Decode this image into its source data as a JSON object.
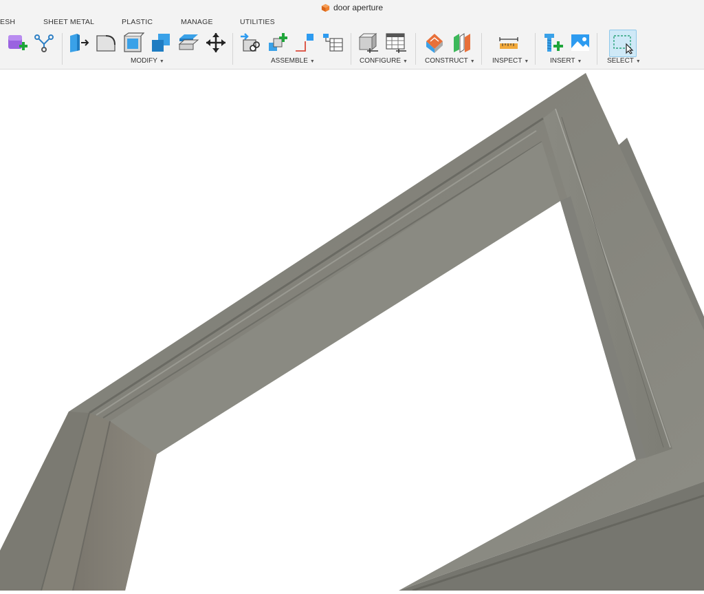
{
  "window": {
    "title": "door aperture",
    "icon": "orange-cube-icon"
  },
  "tabs": [
    {
      "label": "ESH"
    },
    {
      "label": "SHEET METAL"
    },
    {
      "label": "PLASTIC"
    },
    {
      "label": "MANAGE"
    },
    {
      "label": "UTILITIES"
    }
  ],
  "toolbar": {
    "groups": [
      {
        "label": "MODIFY"
      },
      {
        "label": "ASSEMBLE"
      },
      {
        "label": "CONFIGURE"
      },
      {
        "label": "CONSTRUCT"
      },
      {
        "label": "INSPECT"
      },
      {
        "label": "INSERT"
      },
      {
        "label": "SELECT"
      }
    ],
    "icons": [
      "create-form-icon",
      "mesh-utility-icon",
      "press-pull-icon",
      "fillet-icon",
      "shell-icon",
      "combine-icon",
      "offset-face-icon",
      "move-icon",
      "joint-icon",
      "new-component-icon",
      "joint-origin-icon",
      "bill-of-materials-icon",
      "configure-icon",
      "configuration-table-icon",
      "offset-plane-icon",
      "midplane-icon",
      "measure-icon",
      "insert-mcmaster-icon",
      "insert-image-icon",
      "window-select-icon"
    ]
  },
  "colors": {
    "accent_blue": "#2d9bf0",
    "frame_gray": "#8b8b82",
    "toolbar_bg": "#f3f3f3",
    "select_highlight": "#cfe9f7"
  }
}
